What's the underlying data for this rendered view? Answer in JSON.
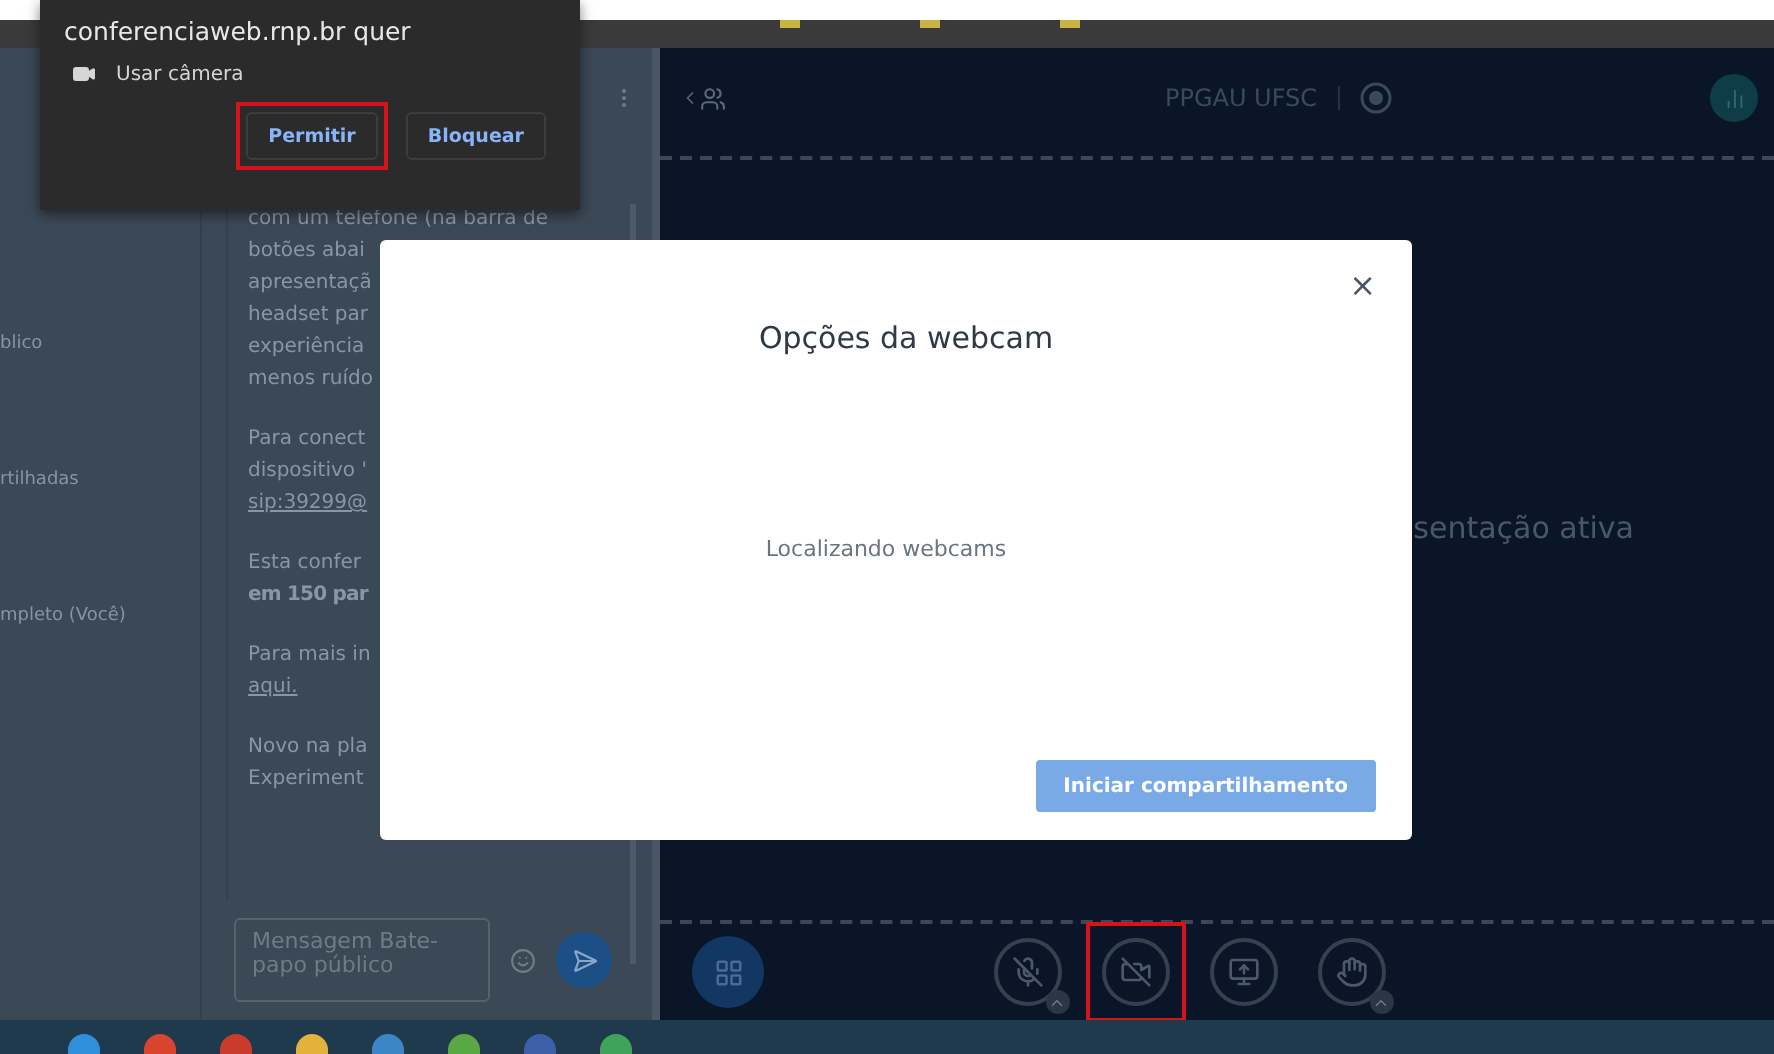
{
  "permission_prompt": {
    "title": "conferenciaweb.rnp.br quer",
    "permission": "Usar câmera",
    "buttons": [
      {
        "label": "Permitir",
        "highlighted": true
      },
      {
        "label": "Bloquear",
        "highlighted": false
      }
    ]
  },
  "user_list": {
    "items": [
      "blico",
      "rtilhadas",
      "mpleto (Você)"
    ]
  },
  "chat": {
    "paragraphs": [
      {
        "lines": [
          {
            "text": "com um telefone (na barra de",
            "kind": "text"
          },
          {
            "text": "botões abai",
            "kind": "text"
          },
          {
            "text": "apresentaçã",
            "kind": "text"
          },
          {
            "text": "headset par",
            "kind": "text"
          },
          {
            "text": "experiência",
            "kind": "text"
          },
          {
            "text": "menos ruído",
            "kind": "text"
          }
        ]
      },
      {
        "lines": [
          {
            "text": "Para conect",
            "kind": "text"
          },
          {
            "text": "dispositivo '",
            "kind": "text"
          },
          {
            "text": "sip:39299@",
            "kind": "link"
          }
        ]
      },
      {
        "lines": [
          {
            "text": "Esta confer",
            "kind": "text"
          },
          {
            "text": "em 150 par",
            "kind": "bold"
          }
        ]
      },
      {
        "lines": [
          {
            "text": "Para mais in",
            "kind": "text"
          },
          {
            "text": "aqui.",
            "kind": "link"
          }
        ]
      },
      {
        "lines": [
          {
            "text": "Novo na pla",
            "kind": "text"
          },
          {
            "text": "Experiment",
            "kind": "text"
          }
        ]
      }
    ],
    "input": {
      "placeholder": "Mensagem Bate-papo público"
    }
  },
  "presentation": {
    "title": "PPGAU UFSC",
    "status": "sentação ativa",
    "controls": [
      {
        "kind": "mic",
        "highlighted": false
      },
      {
        "kind": "camera",
        "highlighted": true
      },
      {
        "kind": "screen",
        "highlighted": false
      },
      {
        "kind": "hand",
        "highlighted": false
      }
    ]
  },
  "dialog": {
    "title": "Opções da webcam",
    "close": "×",
    "message": "Localizando webcams",
    "button": "Iniciar compartilhamento"
  }
}
